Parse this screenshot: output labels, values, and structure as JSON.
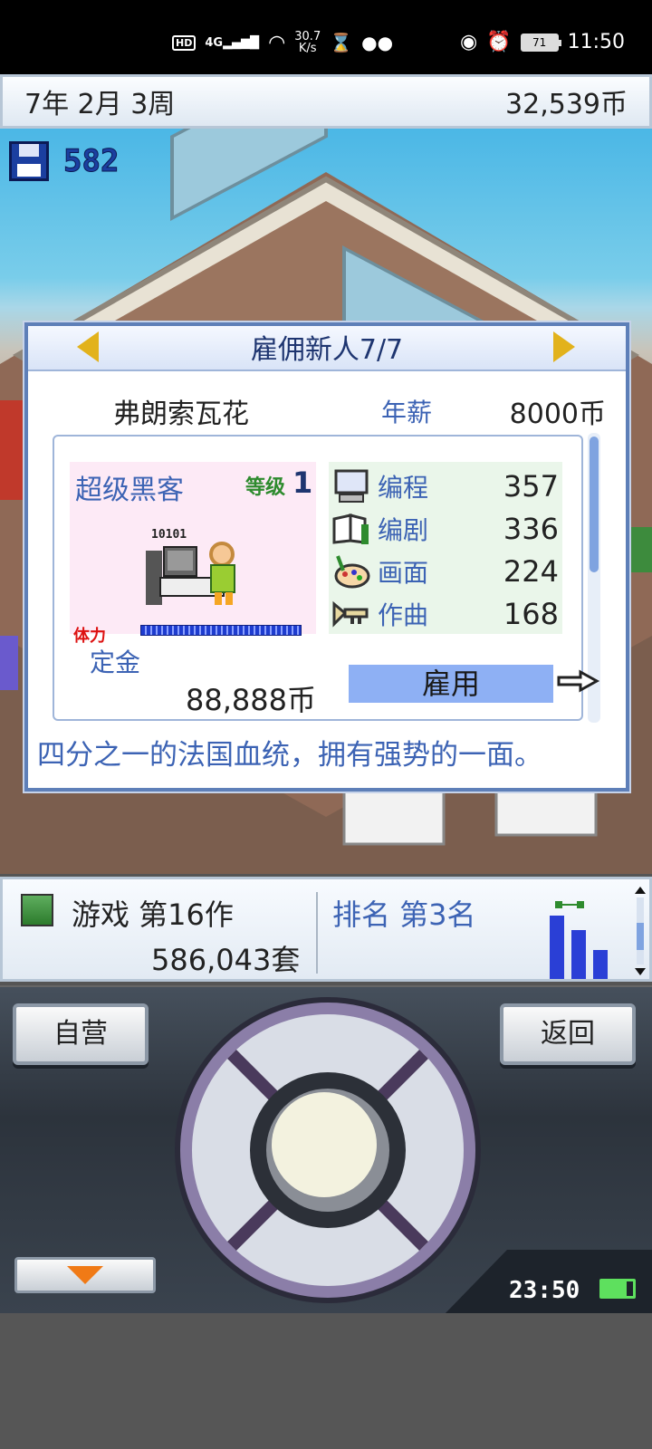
{
  "status_bar": {
    "network_speed": "30.7",
    "network_speed_unit": "K/s",
    "signal_label": "4G",
    "hd_label": "HD",
    "battery": "71",
    "time": "11:50"
  },
  "top_bar": {
    "date": "7年 2月 3周",
    "money": "32,539币"
  },
  "save": {
    "count": "582"
  },
  "dialog": {
    "title": "雇佣新人7/7",
    "candidate": {
      "name": "弗朗索瓦花",
      "salary_label": "年薪",
      "salary": "8000币",
      "job": "超级黑客",
      "level_label": "等级",
      "level": "1",
      "sprite_text": "10101",
      "stamina_label": "体力",
      "stamina": 1.0,
      "stats": [
        {
          "label": "编程",
          "value": "357",
          "icon": "monitor-icon"
        },
        {
          "label": "编剧",
          "value": "336",
          "icon": "book-icon"
        },
        {
          "label": "画面",
          "value": "224",
          "icon": "palette-icon"
        },
        {
          "label": "作曲",
          "value": "168",
          "icon": "trumpet-icon"
        }
      ],
      "deposit_label": "定金",
      "deposit": "88,888币",
      "hire_label": "雇用",
      "description": "四分之一的法国血统，拥有强势的一面。"
    }
  },
  "info_bar": {
    "game_title": "游戏 第16作",
    "game_sales": "586,043套",
    "rank": "排名 第3名"
  },
  "controller": {
    "left_button": "自营",
    "right_button": "返回",
    "clock": "23:50"
  },
  "colors": {
    "accent_blue": "#3c63b4",
    "hire_button": "#8eb0f4",
    "arrow_gold": "#e2b21c",
    "down_arrow_orange": "#f07a16"
  }
}
